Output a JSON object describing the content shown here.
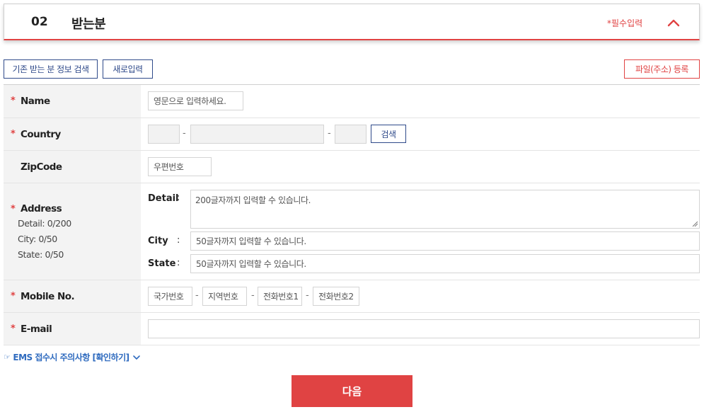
{
  "header": {
    "step_number": "02",
    "title": "받는분",
    "required_note": "*필수입력",
    "collapse_icon": "chevron-up-icon"
  },
  "actions": {
    "search_existing": "기존 받는 분 정보 검색",
    "new_entry": "새로입력",
    "file_register": "파일(주소) 등록"
  },
  "form": {
    "name": {
      "label": "Name",
      "placeholder": "영문으로 입력하세요."
    },
    "country": {
      "label": "Country",
      "field1": "",
      "field2": "",
      "field3": "",
      "search_button": "검색"
    },
    "zipcode": {
      "label": "ZipCode",
      "placeholder": "우편번호"
    },
    "address": {
      "label": "Address",
      "counters": [
        "Detail: 0/200",
        "City: 0/50",
        "State: 0/50"
      ],
      "detail_label": "Detail",
      "detail_placeholder": "200글자까지 입력할 수 있습니다.",
      "city_label": "City",
      "city_placeholder": "50글자까지 입력할 수 있습니다.",
      "state_label": "State",
      "state_placeholder": "50글자까지 입력할 수 있습니다."
    },
    "mobile": {
      "label": "Mobile No.",
      "country_code": "국가번호",
      "area_code": "지역번호",
      "phone1": "전화번호1",
      "phone2": "전화번호2"
    },
    "email": {
      "label": "E-mail",
      "value": ""
    }
  },
  "notice": {
    "icon": "pointing-hand-icon",
    "text": "EMS 접수시 주의사항 [확인하기]",
    "expand_icon": "chevron-down-icon"
  },
  "next_button": "다음",
  "colors": {
    "accent_red": "#e04343",
    "navy": "#2f4a8a",
    "link_blue": "#2f6bbf"
  }
}
